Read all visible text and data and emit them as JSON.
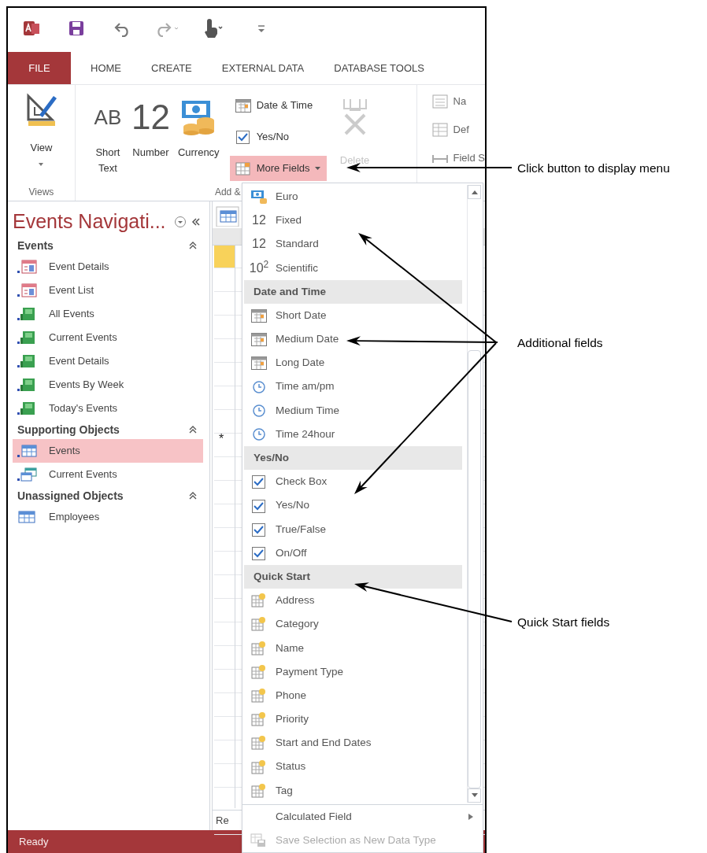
{
  "file_tab": "FILE",
  "tabs": [
    "HOME",
    "CREATE",
    "EXTERNAL DATA",
    "DATABASE TOOLS"
  ],
  "ribbon": {
    "view_button": "View",
    "views_group_label": "Views",
    "large_buttons": [
      {
        "kind": "glyph",
        "glyph": "AB",
        "label": "Short Text"
      },
      {
        "kind": "glyph",
        "glyph": "12",
        "label": "Number"
      },
      {
        "kind": "currency",
        "label": "Currency"
      }
    ],
    "small_buttons": [
      {
        "kind": "calendar",
        "label": "Date & Time",
        "selected": false
      },
      {
        "kind": "checkbox",
        "label": "Yes/No",
        "selected": false
      },
      {
        "kind": "more",
        "label": "More Fields",
        "selected": true
      }
    ],
    "delete_button": {
      "label": "Delete",
      "disabled": true
    },
    "add_group_label": "Add &",
    "properties_buttons": [
      "Na",
      "Def",
      "Field S"
    ]
  },
  "navigation": {
    "title": "Events Navigati...",
    "groups": [
      {
        "label": "Events",
        "items": [
          {
            "kind": "form",
            "label": "Event Details",
            "selected": false
          },
          {
            "kind": "form",
            "label": "Event List",
            "selected": false
          },
          {
            "kind": "report",
            "label": "All Events",
            "selected": false
          },
          {
            "kind": "report",
            "label": "Current Events",
            "selected": false
          },
          {
            "kind": "report",
            "label": "Event Details",
            "selected": false
          },
          {
            "kind": "report",
            "label": "Events By Week",
            "selected": false
          },
          {
            "kind": "report",
            "label": "Today's Events",
            "selected": false
          }
        ]
      },
      {
        "label": "Supporting Objects",
        "items": [
          {
            "kind": "table",
            "label": "Events",
            "selected": true
          },
          {
            "kind": "query",
            "label": "Current Events",
            "selected": false
          }
        ]
      },
      {
        "label": "Unassigned Objects",
        "items": [
          {
            "kind": "plain_table",
            "label": "Employees",
            "selected": false
          }
        ]
      }
    ]
  },
  "datasheet": {
    "new_record_marker": "*",
    "record_nav": "Re"
  },
  "more_fields_menu": {
    "sections": [
      {
        "items": [
          {
            "kind": "currency",
            "label": "Euro"
          },
          {
            "kind": "glyph",
            "glyph": "12",
            "label": "Fixed"
          },
          {
            "kind": "glyph",
            "glyph": "12",
            "label": "Standard"
          },
          {
            "kind": "glyph",
            "glyph": "10$^{2}$",
            "label": "Scientific"
          }
        ]
      },
      {
        "heading": "Date and Time",
        "items": [
          {
            "kind": "calendar",
            "label": "Short Date"
          },
          {
            "kind": "calendar",
            "label": "Medium Date"
          },
          {
            "kind": "calendar",
            "label": "Long Date"
          },
          {
            "kind": "clock",
            "label": "Time am/pm"
          },
          {
            "kind": "clock",
            "label": "Medium Time"
          },
          {
            "kind": "clock",
            "label": "Time 24hour"
          }
        ]
      },
      {
        "heading": "Yes/No",
        "items": [
          {
            "kind": "checkbox",
            "label": "Check Box"
          },
          {
            "kind": "checkbox",
            "label": "Yes/No"
          },
          {
            "kind": "checkbox",
            "label": "True/False"
          },
          {
            "kind": "checkbox",
            "label": "On/Off"
          }
        ]
      },
      {
        "heading": "Quick Start",
        "items": [
          {
            "kind": "quickstart",
            "label": "Address"
          },
          {
            "kind": "quickstart",
            "label": "Category"
          },
          {
            "kind": "quickstart",
            "label": "Name"
          },
          {
            "kind": "quickstart",
            "label": "Payment Type"
          },
          {
            "kind": "quickstart",
            "label": "Phone"
          },
          {
            "kind": "quickstart",
            "label": "Priority"
          },
          {
            "kind": "quickstart",
            "label": "Start and End Dates"
          },
          {
            "kind": "quickstart",
            "label": "Status"
          },
          {
            "kind": "quickstart",
            "label": "Tag"
          }
        ]
      }
    ],
    "footer": [
      {
        "label": "Calculated Field",
        "submenu": true,
        "disabled": false
      },
      {
        "label": "Save Selection as New Data Type",
        "submenu": false,
        "disabled": true
      }
    ]
  },
  "status_bar": "Ready",
  "callouts": [
    {
      "label": "Click button to display menu"
    },
    {
      "label": "Additional fields"
    },
    {
      "label": "Quick Start fields"
    }
  ]
}
